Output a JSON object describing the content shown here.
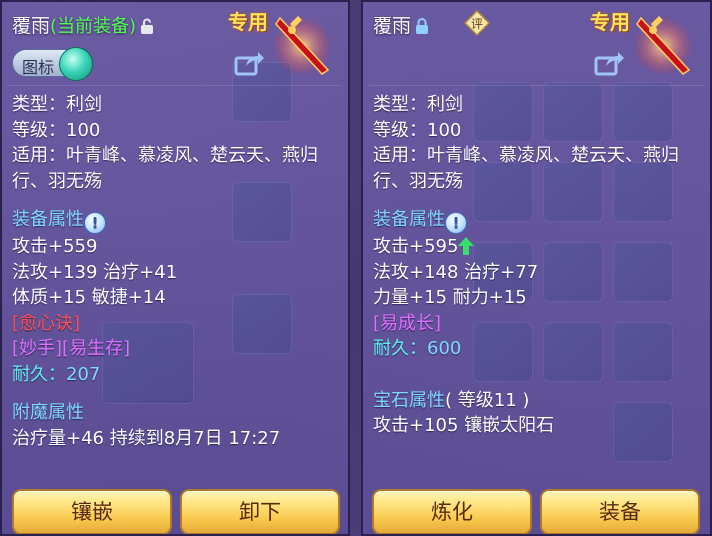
{
  "left": {
    "item_name": "覆雨",
    "equipped_tag": "(当前装备)",
    "special_tag": "专用",
    "toggle_label": "图标",
    "type": "类型：利剑",
    "level": "等级：100",
    "usable_by": "适用：叶青峰、慕凌风、楚云天、燕归行、羽无殇",
    "equip_attr_title": "装备属性",
    "attack": "攻击+559",
    "magic_heal": "法攻+139 治疗+41",
    "stats": "体质+15 敏捷+14",
    "skill_red": "[愈心诀]",
    "skill_purple": "[妙手][易生存]",
    "durability_label": "耐久：",
    "durability_value": "207",
    "enchant_title": "附魔属性",
    "enchant_line": "治疗量+46 持续到8月7日 17:27",
    "btn_inlay": "镶嵌",
    "btn_unequip": "卸下"
  },
  "right": {
    "item_name": "覆雨",
    "rate_icon_label": "评",
    "special_tag": "专用",
    "type": "类型：利剑",
    "level": "等级：100",
    "usable_by": "适用：叶青峰、慕凌风、楚云天、燕归行、羽无殇",
    "equip_attr_title": "装备属性",
    "attack": "攻击+595",
    "magic_heal": "法攻+148 治疗+77",
    "stats": "力量+15 耐力+15",
    "skill_purple": "[易成长]",
    "durability_label": "耐久：",
    "durability_value": "600",
    "gem_title": "宝石属性",
    "gem_level": "( 等级11 )",
    "gem_line": "攻击+105 镶嵌太阳石",
    "btn_refine": "炼化",
    "btn_equip": "装备"
  },
  "icons": {
    "lock_open": "unlock-icon",
    "lock_closed": "lock-icon",
    "share": "share-icon",
    "sword": "sword-icon",
    "info": "info-icon",
    "arrow_up": "arrow-up-icon"
  },
  "colors": {
    "equipped_green": "#52ff52",
    "section_blue": "#7fd8ff",
    "skill_red": "#ff5050",
    "skill_purple": "#e070ff",
    "button_gold": "#f7c64a"
  }
}
